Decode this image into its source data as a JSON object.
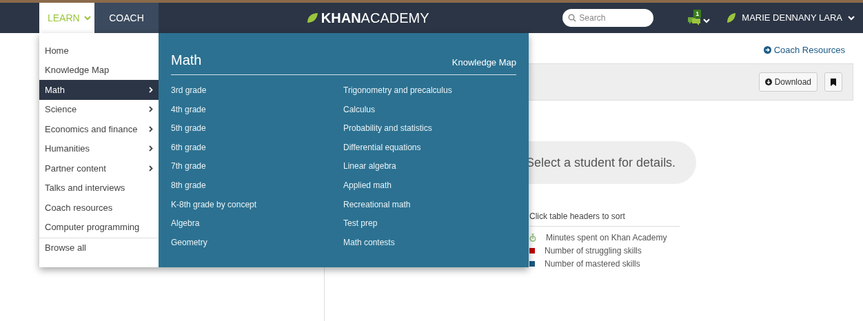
{
  "nav": {
    "tabs": [
      {
        "label": "LEARN",
        "selected": true,
        "has_caret": true
      },
      {
        "label": "COACH",
        "selected": false,
        "has_caret": false
      }
    ],
    "logo": {
      "bold": "KHAN",
      "light": "ACADEMY"
    },
    "search": {
      "placeholder": "Search"
    },
    "notifications": {
      "count": "1"
    },
    "user": {
      "name": "MARIE DENNANY LARA"
    }
  },
  "learn_menu": {
    "items": [
      {
        "label": "Home",
        "has_submenu": false,
        "selected": false
      },
      {
        "label": "Knowledge Map",
        "has_submenu": false,
        "selected": false
      },
      {
        "label": "Math",
        "has_submenu": true,
        "selected": true
      },
      {
        "label": "Science",
        "has_submenu": true,
        "selected": false
      },
      {
        "label": "Economics and finance",
        "has_submenu": true,
        "selected": false
      },
      {
        "label": "Humanities",
        "has_submenu": true,
        "selected": false
      },
      {
        "label": "Partner content",
        "has_submenu": true,
        "selected": false
      },
      {
        "label": "Talks and interviews",
        "has_submenu": false,
        "selected": false
      },
      {
        "label": "Coach resources",
        "has_submenu": false,
        "selected": false
      },
      {
        "label": "Computer programming",
        "has_submenu": false,
        "selected": false
      }
    ],
    "footer_item": "Browse all"
  },
  "submenu": {
    "title": "Math",
    "link": "Knowledge Map",
    "columns": [
      [
        "3rd grade",
        "4th grade",
        "5th grade",
        "6th grade",
        "7th grade",
        "8th grade",
        "K-8th grade by concept",
        "Algebra",
        "Geometry"
      ],
      [
        "Trigonometry and precalculus",
        "Calculus",
        "Probability and statistics",
        "Differential equations",
        "Linear algebra",
        "Applied math",
        "Recreational math",
        "Test prep",
        "Math contests"
      ]
    ]
  },
  "page": {
    "coach_link": "Coach Resources",
    "download": "Download",
    "empty_message": "Select a student for details.",
    "legend_title": "Click table headers to sort",
    "legend": [
      {
        "kind": "timer",
        "label": "Minutes spent on Khan Academy",
        "color": "#9cc488"
      },
      {
        "kind": "square",
        "label": "Number of struggling skills",
        "color": "#c00000"
      },
      {
        "kind": "square",
        "label": "Number of mastered skills",
        "color": "#1c5a85"
      }
    ]
  }
}
